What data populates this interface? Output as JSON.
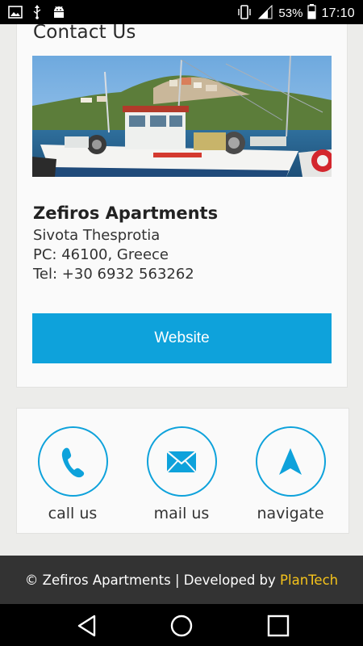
{
  "status_bar": {
    "battery_percent": "53%",
    "time": "17:10"
  },
  "contact": {
    "title": "Contact Us",
    "business_name": "Zefiros Apartments",
    "address_line1": "Sivota Thesprotia",
    "address_line2": "PC: 46100, Greece",
    "phone_line": "Tel: +30 6932 563262",
    "website_label": "Website"
  },
  "actions": {
    "call_label": "call us",
    "mail_label": "mail us",
    "navigate_label": "navigate"
  },
  "footer": {
    "copyright": "© Zefiros Apartments | Developed by ",
    "developer": "PlanTech"
  },
  "colors": {
    "accent": "#0ea2db",
    "footer_bg": "#333333",
    "brand_highlight": "#f5c31b"
  },
  "icons": [
    "image-icon",
    "usb-icon",
    "android-icon",
    "vibrate-icon",
    "signal-icon",
    "battery-icon",
    "phone-icon",
    "mail-icon",
    "navigate-arrow-icon",
    "back-icon",
    "home-icon",
    "recent-apps-icon"
  ]
}
